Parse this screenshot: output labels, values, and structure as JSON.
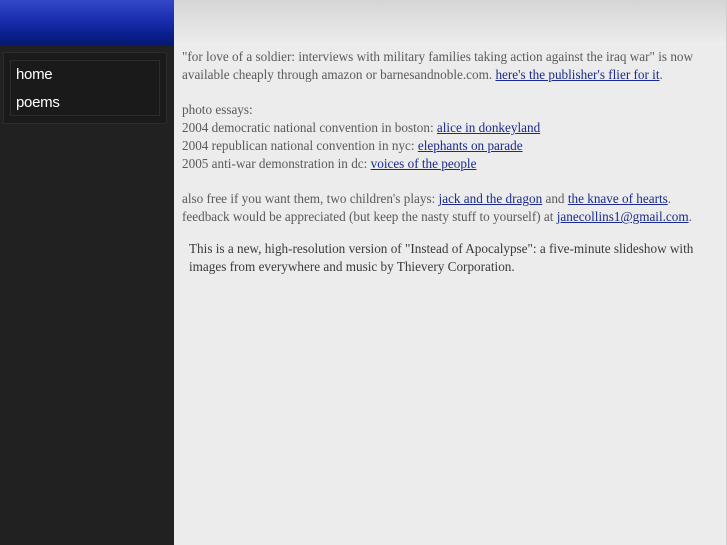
{
  "sidebar": {
    "nav": [
      {
        "label": "home"
      },
      {
        "label": "poems"
      }
    ]
  },
  "main": {
    "book": {
      "text": "\"for love of a soldier: interviews with military families taking action against the iraq war\" is now available cheaply through amazon or barnesandnoble.com. ",
      "link": "here's the publisher's flier for it",
      "after": "."
    },
    "photo_essays": {
      "heading": "photo essays:",
      "items": [
        {
          "prefix": "2004 democratic national convention in boston: ",
          "link": "alice in donkeyland"
        },
        {
          "prefix": "2004 republican national convention in nyc: ",
          "link": "elephants on parade"
        },
        {
          "prefix": "2005 anti-war demonstration in dc: ",
          "link": "voices of the people"
        }
      ]
    },
    "plays": {
      "prefix": "also free if you want them, two children's plays: ",
      "link1": "jack and the dragon",
      "middle": " and ",
      "link2": "the knave of hearts",
      "after": "."
    },
    "feedback": {
      "prefix": "feedback would be appreciated (but keep the nasty stuff to yourself) at ",
      "link": "janecollins1@gmail.com",
      "after": "."
    },
    "video": {
      "text": "This is a new, high-resolution version of \"Instead of Apocalypse\": a five-minute slideshow with images from everywhere and music by Thievery Corporation."
    }
  }
}
